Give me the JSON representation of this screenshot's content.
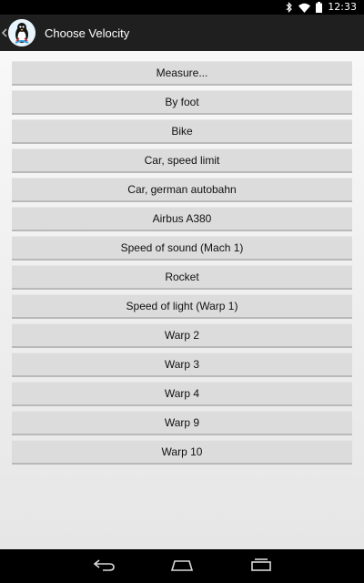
{
  "status_bar": {
    "time": "12:33",
    "icons": [
      "bluetooth-icon",
      "wifi-icon",
      "battery-icon"
    ]
  },
  "action_bar": {
    "title": "Choose Velocity",
    "back_icon": "chevron-left-icon",
    "app_icon": "penguin-app-icon"
  },
  "velocities": [
    "Measure...",
    "By foot",
    "Bike",
    "Car, speed limit",
    "Car, german autobahn",
    "Airbus A380",
    "Speed of sound (Mach 1)",
    "Rocket",
    "Speed of light (Warp 1)",
    "Warp 2",
    "Warp 3",
    "Warp 4",
    "Warp 9",
    "Warp 10"
  ],
  "navigation_bar": {
    "buttons": [
      "back-icon",
      "home-icon",
      "recents-icon"
    ]
  },
  "colors": {
    "status_bar": "#000000",
    "action_bar": "#1f1f1f",
    "button_bg": "#dcdcdc",
    "button_text": "#111111"
  }
}
